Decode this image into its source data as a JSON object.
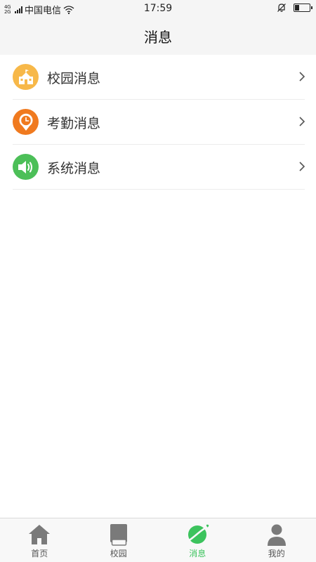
{
  "status_bar": {
    "network_top": "4G",
    "network_bottom": "2G",
    "carrier": "中国电信",
    "time": "17:59",
    "battery_level": 0.25
  },
  "header": {
    "title": "消息"
  },
  "messages": {
    "items": [
      {
        "label": "校园消息",
        "icon": "school-icon",
        "color": "#f7b849"
      },
      {
        "label": "考勤消息",
        "icon": "clock-pin-icon",
        "color": "#f07a1f"
      },
      {
        "label": "系统消息",
        "icon": "speaker-icon",
        "color": "#4cbf58"
      }
    ]
  },
  "tab_bar": {
    "active_index": 2,
    "active_color": "#3cc35d",
    "inactive_color": "#7a7a7a",
    "tabs": [
      {
        "label": "首页",
        "icon": "home-icon"
      },
      {
        "label": "校园",
        "icon": "book-icon"
      },
      {
        "label": "消息",
        "icon": "planet-icon"
      },
      {
        "label": "我的",
        "icon": "user-icon"
      }
    ]
  }
}
